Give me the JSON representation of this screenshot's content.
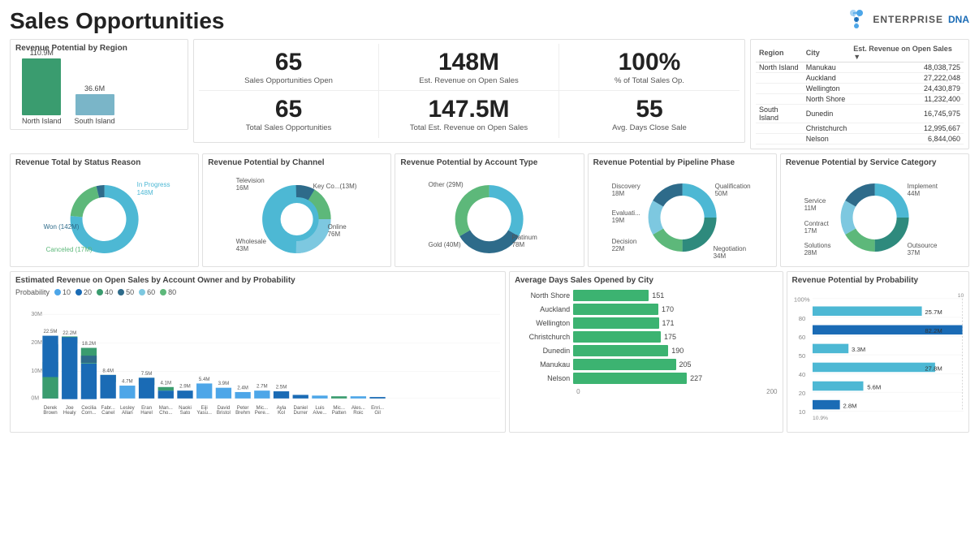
{
  "page": {
    "title": "Sales Opportunities",
    "brand": {
      "enterprise": "ENTERPRISE",
      "dna": "DNA"
    }
  },
  "kpis": [
    {
      "value": "65",
      "label": "Sales Opportunities Open"
    },
    {
      "value": "148M",
      "label": "Est. Revenue on Open Sales"
    },
    {
      "value": "100%",
      "label": "% of Total Sales Op."
    },
    {
      "value": "65",
      "label": "Total Sales Opportunities"
    },
    {
      "value": "147.5M",
      "label": "Total Est. Revenue on Open Sales"
    },
    {
      "value": "55",
      "label": "Avg. Days Close Sale"
    }
  ],
  "region_chart": {
    "title": "Revenue Potential by Region",
    "bars": [
      {
        "label": "North Island",
        "value": "110.9M",
        "height": 75,
        "color": "#3a9c6f"
      },
      {
        "label": "South Island",
        "value": "36.6M",
        "height": 30,
        "color": "#7ab5c8"
      }
    ]
  },
  "region_table": {
    "headers": [
      "Region",
      "City",
      "Est. Revenue on Open Sales"
    ],
    "rows": [
      {
        "region": "North Island",
        "city": "Manukau",
        "value": "48,038,725"
      },
      {
        "region": "",
        "city": "Auckland",
        "value": "27,222,048"
      },
      {
        "region": "",
        "city": "Wellington",
        "value": "24,430,879"
      },
      {
        "region": "",
        "city": "North Shore",
        "value": "11,232,400"
      },
      {
        "region": "South Island",
        "city": "Dunedin",
        "value": "16,745,975"
      },
      {
        "region": "",
        "city": "Christchurch",
        "value": "12,995,667"
      },
      {
        "region": "",
        "city": "Nelson",
        "value": "6,844,060"
      }
    ]
  },
  "donut_status": {
    "title": "Revenue Total by Status Reason",
    "segments": [
      {
        "label": "In Progress 148M",
        "value": 148,
        "color": "#4db8d4",
        "percent": 50
      },
      {
        "label": "Won (142M)",
        "value": 142,
        "color": "#2e6b8a",
        "percent": 46
      },
      {
        "label": "Canceled (17M)",
        "value": 17,
        "color": "#5db87a",
        "percent": 4
      }
    ]
  },
  "donut_channel": {
    "title": "Revenue Potential by Channel",
    "segments": [
      {
        "label": "Online 76M",
        "value": 76,
        "color": "#4db8d4",
        "percent": 49
      },
      {
        "label": "Wholesale 43M",
        "value": 43,
        "color": "#2e6b8a",
        "percent": 28
      },
      {
        "label": "Television 16M",
        "value": 16,
        "color": "#7dc8e0",
        "percent": 10
      },
      {
        "label": "Key Co...(13M)",
        "value": 13,
        "color": "#5db87a",
        "percent": 8
      }
    ]
  },
  "donut_account": {
    "title": "Revenue Potential by Account Type",
    "segments": [
      {
        "label": "Platinum 78M",
        "value": 78,
        "color": "#4db8d4",
        "percent": 52
      },
      {
        "label": "Gold (40M)",
        "value": 40,
        "color": "#2e6b8a",
        "percent": 27
      },
      {
        "label": "Other (29M)",
        "value": 29,
        "color": "#5db87a",
        "percent": 21
      }
    ]
  },
  "donut_pipeline": {
    "title": "Revenue Potential by Pipeline Phase",
    "segments": [
      {
        "label": "Qualification 50M",
        "value": 50,
        "color": "#4db8d4",
        "percent": 35
      },
      {
        "label": "Negotiation 34M",
        "value": 34,
        "color": "#2e8a7d",
        "percent": 24
      },
      {
        "label": "Decision 22M",
        "value": 22,
        "color": "#5db87a",
        "percent": 15
      },
      {
        "label": "Evaluati... 19M",
        "value": 19,
        "color": "#7dc8e0",
        "percent": 13
      },
      {
        "label": "Discovery 18M",
        "value": 18,
        "color": "#2e6b8a",
        "percent": 12
      }
    ]
  },
  "donut_service": {
    "title": "Revenue Potential by Service Category",
    "segments": [
      {
        "label": "Implement 44M",
        "value": 44,
        "color": "#4db8d4",
        "percent": 30
      },
      {
        "label": "Outsource 37M",
        "value": 37,
        "color": "#2e8a7d",
        "percent": 25
      },
      {
        "label": "Solutions 28M",
        "value": 28,
        "color": "#5db87a",
        "percent": 19
      },
      {
        "label": "Contract 17M",
        "value": 17,
        "color": "#7dc8e0",
        "percent": 12
      },
      {
        "label": "Service 11M",
        "value": 11,
        "color": "#2e6b8a",
        "percent": 8
      }
    ]
  },
  "bar_chart_owners": {
    "title": "Estimated Revenue on Open Sales by Account Owner and by Probability",
    "legend": [
      "10",
      "20",
      "40",
      "50",
      "60",
      "80"
    ],
    "legend_colors": [
      "#4da6e8",
      "#1a6bb5",
      "#3a9c6f",
      "#2e6b8a",
      "#7dc8e0",
      "#5db87a"
    ],
    "y_max": "30M",
    "y_labels": [
      "30M",
      "20M",
      "10M",
      "0M"
    ],
    "columns": [
      {
        "owner": "Derek Brown",
        "total_label": "22.5M",
        "total": 22.5,
        "segments": [
          {
            "v": 7.6,
            "c": "#3a9c6f"
          },
          {
            "v": 14.9,
            "c": "#1a6bb5"
          }
        ]
      },
      {
        "owner": "Joe Healy",
        "total_label": "22.2M",
        "total": 22.2,
        "segments": [
          {
            "v": 2.2,
            "c": "#3a9c6f"
          },
          {
            "v": 20,
            "c": "#1a6bb5"
          }
        ]
      },
      {
        "owner": "Cecilia Corn...",
        "total_label": "18.2M",
        "total": 18.2,
        "segments": [
          {
            "v": 5.6,
            "c": "#3a9c6f"
          },
          {
            "v": 2.5,
            "c": "#2e6b8a"
          },
          {
            "v": 2.2,
            "c": "#4da6e8"
          },
          {
            "v": 8.4,
            "c": "#1a6bb5"
          }
        ]
      },
      {
        "owner": "Fabr... Canel",
        "total_label": "8.4M",
        "total": 8.4,
        "segments": [
          {
            "v": 2.5,
            "c": "#3a9c6f"
          },
          {
            "v": 5.9,
            "c": "#1a6bb5"
          }
        ]
      },
      {
        "owner": "Lesley Allan",
        "total_label": "4.7M",
        "total": 4.7,
        "segments": [
          {
            "v": 4.7,
            "c": "#4da6e8"
          }
        ]
      },
      {
        "owner": "Eran Harel",
        "total_label": "7.5M",
        "total": 7.5,
        "segments": [
          {
            "v": 5.5,
            "c": "#1a6bb5"
          },
          {
            "v": 2,
            "c": "#3a9c6f"
          }
        ]
      },
      {
        "owner": "Man... Cho...",
        "total_label": "4.1M",
        "total": 4.1,
        "segments": [
          {
            "v": 2.8,
            "c": "#1a6bb5"
          },
          {
            "v": 1.3,
            "c": "#3a9c6f"
          }
        ]
      },
      {
        "owner": "Naoki Sato",
        "total_label": "2.9M",
        "total": 2.9,
        "segments": [
          {
            "v": 3.1,
            "c": "#1a6bb5"
          }
        ]
      },
      {
        "owner": "Eiji Yasu...",
        "total_label": "5.4M",
        "total": 5.4,
        "segments": [
          {
            "v": 5.4,
            "c": "#4da6e8"
          }
        ]
      },
      {
        "owner": "David Bristol",
        "total_label": "3.9M",
        "total": 3.9,
        "segments": [
          {
            "v": 3.9,
            "c": "#4da6e8"
          }
        ]
      },
      {
        "owner": "Peter Brehm",
        "total_label": "2.4M",
        "total": 2.4,
        "segments": [
          {
            "v": 2.4,
            "c": "#4da6e8"
          }
        ]
      },
      {
        "owner": "Mic... Pere...",
        "total_label": "2.7M",
        "total": 2.7,
        "segments": [
          {
            "v": 2.7,
            "c": "#4da6e8"
          }
        ]
      },
      {
        "owner": "Ayla Kol",
        "total_label": "2.5M",
        "total": 2.5,
        "segments": [
          {
            "v": 2.5,
            "c": "#1a6bb5"
          }
        ]
      },
      {
        "owner": "Daniel Durrer",
        "total_label": "",
        "total": 1.2,
        "segments": [
          {
            "v": 1.2,
            "c": "#1a6bb5"
          }
        ]
      },
      {
        "owner": "Luis Alve...",
        "total_label": "",
        "total": 1.0,
        "segments": [
          {
            "v": 1.0,
            "c": "#4da6e8"
          }
        ]
      },
      {
        "owner": "Mic... Patten",
        "total_label": "",
        "total": 0.8,
        "segments": [
          {
            "v": 0.8,
            "c": "#3a9c6f"
          }
        ]
      },
      {
        "owner": "Ales... Roic",
        "total_label": "",
        "total": 0.6,
        "segments": [
          {
            "v": 0.6,
            "c": "#4da6e8"
          }
        ]
      },
      {
        "owner": "Enri... Gil",
        "total_label": "",
        "total": 0.5,
        "segments": [
          {
            "v": 0.5,
            "c": "#1a6bb5"
          }
        ]
      }
    ]
  },
  "city_bars": {
    "title": "Average Days Sales Opened by City",
    "x_max": 200,
    "bars": [
      {
        "label": "North Shore",
        "value": 151
      },
      {
        "label": "Auckland",
        "value": 170
      },
      {
        "label": "Wellington",
        "value": 171
      },
      {
        "label": "Christchurch",
        "value": 175
      },
      {
        "label": "Dunedin",
        "value": 190
      },
      {
        "label": "Manukau",
        "value": 205
      },
      {
        "label": "Nelson",
        "value": 227
      }
    ],
    "x_labels": [
      "0",
      "200"
    ]
  },
  "probability_chart": {
    "title": "Revenue Potential by Probability",
    "y_labels": [
      "100%",
      "80",
      "60",
      "50",
      "40",
      "20",
      "10"
    ],
    "bars": [
      {
        "label": "25.7M",
        "value": 25.7,
        "color": "#4db8d4",
        "prob": "80",
        "width_pct": 72
      },
      {
        "label": "82.2M",
        "value": 82.2,
        "color": "#1a6bb5",
        "prob": "60",
        "width_pct": 100
      },
      {
        "label": "3.3M",
        "value": 3.3,
        "color": "#4db8d4",
        "prob": "50",
        "width_pct": 20
      },
      {
        "label": "27.8M",
        "value": 27.8,
        "color": "#4db8d4",
        "prob": "40",
        "width_pct": 78
      },
      {
        "label": "5.6M",
        "value": 5.6,
        "color": "#4db8d4",
        "prob": "20",
        "width_pct": 32
      },
      {
        "label": "2.8M",
        "value": 2.8,
        "color": "#1a6bb5",
        "prob": "10",
        "width_pct": 18
      }
    ],
    "footer": "10.9%"
  }
}
